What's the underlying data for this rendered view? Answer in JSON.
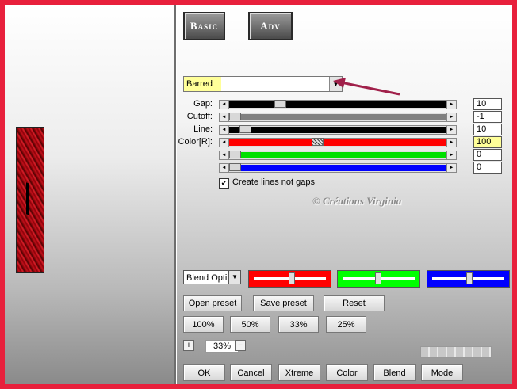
{
  "tabs": {
    "basic": "Basic",
    "adv": "Adv"
  },
  "preset_dropdown": {
    "value": "Barred"
  },
  "sliders": [
    {
      "label": "Gap:",
      "value": "10",
      "level": 0.22,
      "color": "#000000"
    },
    {
      "label": "Cutoff:",
      "value": "-1",
      "level": 0.0,
      "color": "#808080"
    },
    {
      "label": "Line:",
      "value": "10",
      "level": 0.05,
      "color": "#000000"
    },
    {
      "label": "Color[R]:",
      "value": "100",
      "level": 0.4,
      "color": "#ff0000"
    },
    {
      "label": "",
      "value": "0",
      "level": 0.0,
      "color": "#00e000"
    },
    {
      "label": "",
      "value": "0",
      "level": 0.0,
      "color": "#0000ff"
    }
  ],
  "checkbox": {
    "label": "Create lines not gaps",
    "checked": "✔"
  },
  "watermark": "© Créations Virginia",
  "blend_select": {
    "value": "Blend Opti"
  },
  "color_boxes": [
    "#ff0000",
    "#00ff00",
    "#0000ff"
  ],
  "buttons": {
    "open_preset": "Open preset",
    "save_preset": "Save preset",
    "reset": "Reset",
    "z100": "100%",
    "z50": "50%",
    "z33": "33%",
    "z25": "25%",
    "ok": "OK",
    "cancel": "Cancel",
    "xtreme": "Xtreme",
    "color": "Color",
    "blend": "Blend",
    "mode": "Mode"
  },
  "zoom": {
    "value": "33%",
    "plus": "+",
    "minus": "−"
  },
  "icons": {
    "dropdown_arrow": "▼",
    "scroll_left": "◄",
    "scroll_right": "►"
  }
}
